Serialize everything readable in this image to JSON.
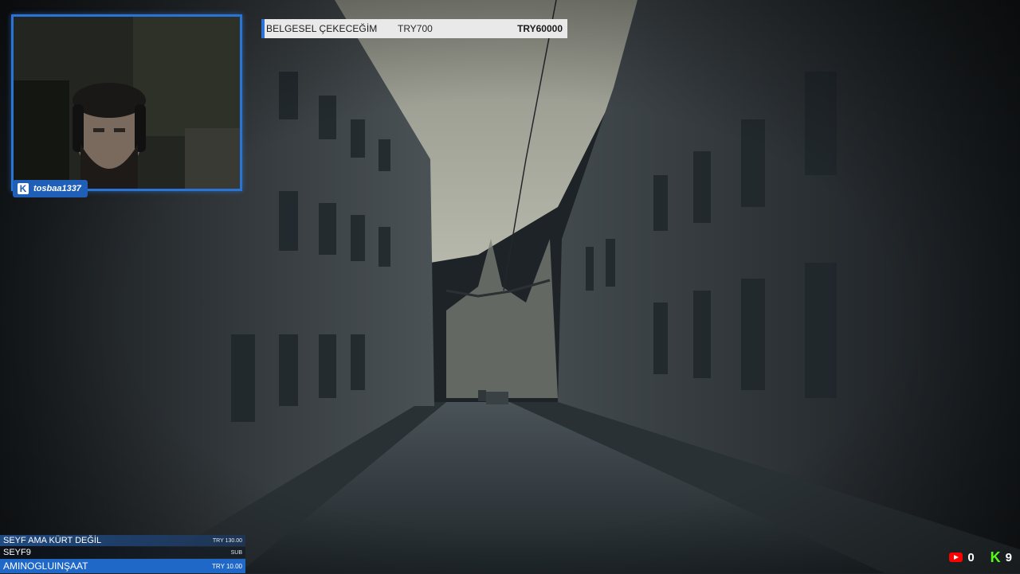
{
  "stream": {
    "streamer": "tosbaa1337",
    "platform_icon": "kick-logo-icon"
  },
  "goal": {
    "title": "BELGESEL ÇEKECEĞİM",
    "current": "TRY700",
    "target": "TRY60000"
  },
  "donations": [
    {
      "name": "SEYF AMA KÜRT DEĞİL",
      "amount": "TRY 130.00"
    },
    {
      "name": "SEYF9",
      "amount": "SUB"
    },
    {
      "name": "AMINOGLUINŞAAT",
      "amount": "TRY 10.00"
    }
  ],
  "viewers": {
    "youtube_icon": "youtube-icon",
    "youtube_count": "0",
    "kick_icon": "kick-icon",
    "kick_count": "9"
  },
  "colors": {
    "accent": "#2b74d6",
    "kick_green": "#53fc18",
    "youtube_red": "#ff0000"
  }
}
